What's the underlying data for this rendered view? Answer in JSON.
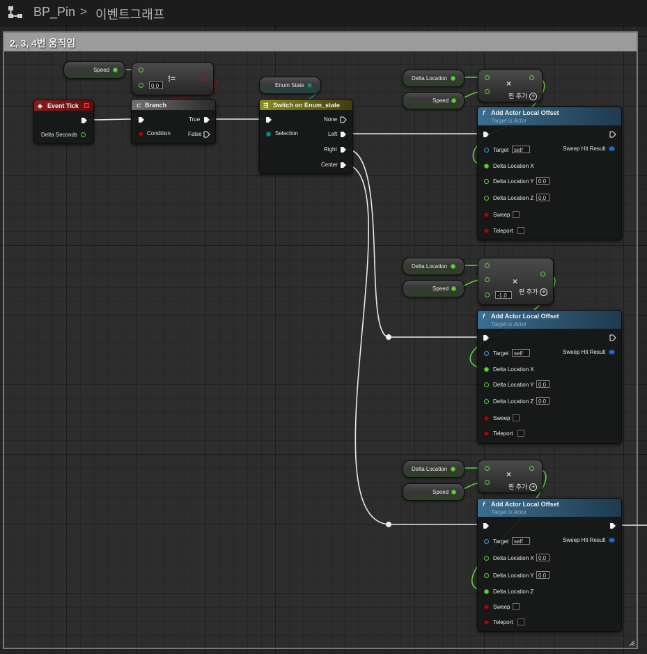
{
  "breadcrumb": {
    "blueprint": "BP_Pin",
    "separator": ">",
    "graph": "이벤트그래프"
  },
  "comment": {
    "title": "2, 3, 4번 움직임"
  },
  "colors": {
    "exec": "#f4f4f4",
    "float": "#5ed43c",
    "bool": "#9a0c0c",
    "object": "#3a9ee6",
    "enum": "#148d84",
    "event_header": "#8a1d1d",
    "function_header": "#3b6e90",
    "switch_header": "#8d8c1c"
  },
  "nodes": {
    "speed_top": {
      "label": "Speed"
    },
    "not_equal": {
      "operator": "!=",
      "value": "0.0"
    },
    "event_tick": {
      "title": "Event Tick",
      "delta_seconds": "Delta Seconds"
    },
    "branch": {
      "title": "Branch",
      "condition": "Condition",
      "true": "True",
      "false": "False"
    },
    "enum_state": {
      "label": "Enum State"
    },
    "switch": {
      "title": "Switch on Enum_state",
      "selection": "Selection",
      "outputs": [
        "None",
        "Left",
        "Right",
        "Center"
      ]
    },
    "group1": {
      "delta_location": "Delta Location",
      "speed": "Speed",
      "multiply": {
        "operator": "×",
        "add_pin": "핀 추가"
      },
      "offset": {
        "title": "Add Actor Local Offset",
        "subtitle": "Target is Actor",
        "target": "Target",
        "self": "self",
        "sweep_hit": "Sweep Hit Result",
        "x": "Delta Location X",
        "y": "Delta Location Y",
        "y_value": "0.0",
        "z": "Delta Location Z",
        "z_value": "0.0",
        "sweep": "Sweep",
        "teleport": "Teleport"
      }
    },
    "group2": {
      "delta_location": "Delta Location",
      "speed": "Speed",
      "multiply": {
        "operator": "×",
        "add_pin": "핀 추가",
        "value": "-1.0"
      },
      "offset": {
        "title": "Add Actor Local Offset",
        "subtitle": "Target is Actor",
        "target": "Target",
        "self": "self",
        "sweep_hit": "Sweep Hit Result",
        "x": "Delta Location X",
        "y": "Delta Location Y",
        "y_value": "0.0",
        "z": "Delta Location Z",
        "z_value": "0.0",
        "sweep": "Sweep",
        "teleport": "Teleport"
      }
    },
    "group3": {
      "delta_location": "Delta Location",
      "speed": "Speed",
      "multiply": {
        "operator": "×",
        "add_pin": "핀 추가"
      },
      "offset": {
        "title": "Add Actor Local Offset",
        "subtitle": "Target is Actor",
        "target": "Target",
        "self": "self",
        "sweep_hit": "Sweep Hit Result",
        "x": "Delta Location X",
        "x_value": "0.0",
        "y": "Delta Location Y",
        "y_value": "0.0",
        "z": "Delta Location Z",
        "sweep": "Sweep",
        "teleport": "Teleport"
      }
    }
  }
}
